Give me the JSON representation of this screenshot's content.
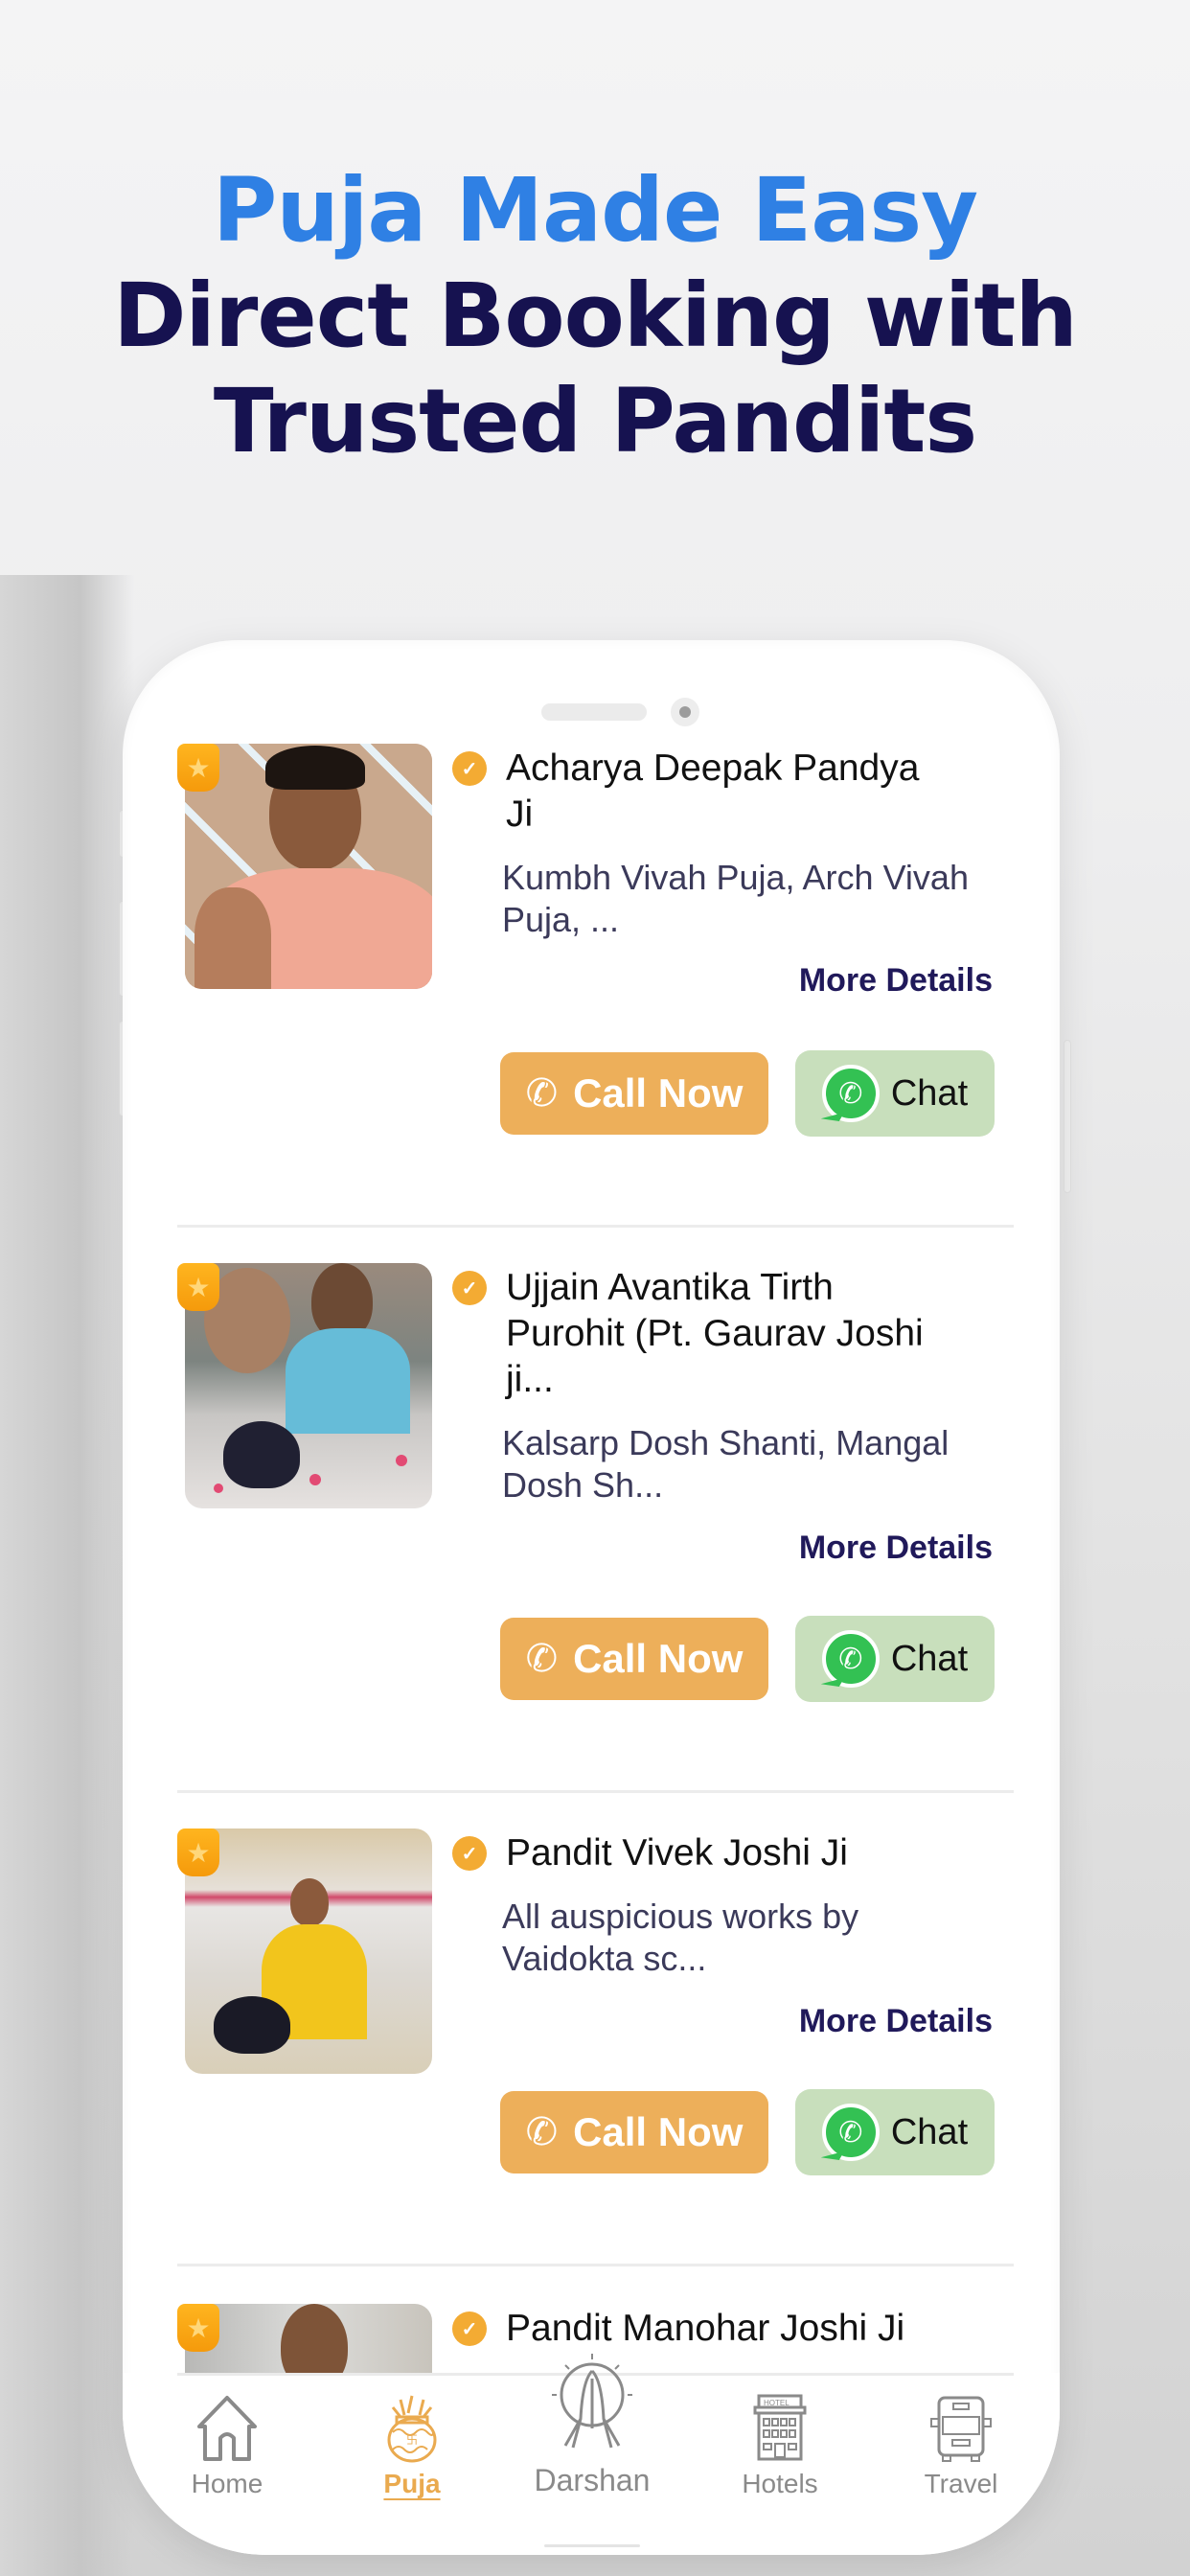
{
  "headline": {
    "line1": "Puja Made Easy",
    "line2": "Direct Booking with",
    "line3": "Trusted Pandits"
  },
  "colors": {
    "accent_blue": "#2f80e4",
    "navy": "#161250",
    "call_button": "#edaf5a",
    "chat_button": "#c8dfbc",
    "active_nav": "#eaaa4f"
  },
  "cards": [
    {
      "name": "Acharya Deepak Pandya Ji",
      "services": "Kumbh Vivah Puja, Arch Vivah Puja, ...",
      "more_label": "More Details",
      "call_label": "Call Now",
      "chat_label": "Chat",
      "badge_icon": "star-badge-icon",
      "verified_icon": "verified-check-icon"
    },
    {
      "name": "Ujjain Avantika Tirth Purohit (Pt. Gaurav Joshi ji...",
      "services": "Kalsarp Dosh Shanti, Mangal Dosh Sh...",
      "more_label": "More Details",
      "call_label": "Call Now",
      "chat_label": "Chat",
      "badge_icon": "star-badge-icon",
      "verified_icon": "verified-check-icon"
    },
    {
      "name": "Pandit Vivek Joshi Ji",
      "services": "All auspicious works by Vaidokta sc...",
      "more_label": "More Details",
      "call_label": "Call Now",
      "chat_label": "Chat",
      "badge_icon": "star-badge-icon",
      "verified_icon": "verified-check-icon"
    },
    {
      "name": "Pandit Manohar Joshi Ji",
      "badge_icon": "star-badge-icon",
      "verified_icon": "verified-check-icon"
    }
  ],
  "nav": {
    "items": [
      {
        "label": "Home",
        "icon": "home-icon",
        "active": false
      },
      {
        "label": "Puja",
        "icon": "kalash-icon",
        "active": true
      },
      {
        "label": "Darshan",
        "icon": "namaste-hands-icon",
        "active": false
      },
      {
        "label": "Hotels",
        "icon": "hotel-building-icon",
        "active": false
      },
      {
        "label": "Travel",
        "icon": "bus-icon",
        "active": false
      }
    ]
  }
}
